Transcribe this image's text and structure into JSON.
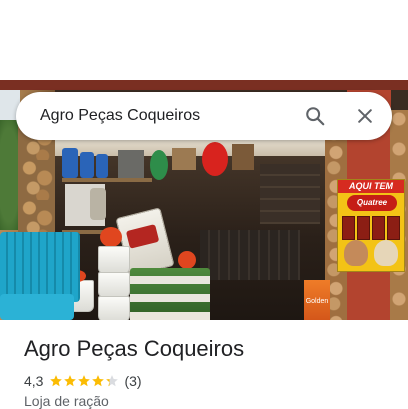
{
  "search": {
    "query": "Agro Peças Coqueiros",
    "search_icon": "search-icon",
    "clear_icon": "close-icon"
  },
  "photo": {
    "poster_heading": "AQUI TEM",
    "poster_brand": "Quatree",
    "bag_label": "Golden"
  },
  "place": {
    "name": "Agro Peças Coqueiros",
    "rating": "4,3",
    "rating_value": 4.3,
    "rating_max": 5,
    "review_count": "(3)",
    "category": "Loja de ração"
  },
  "colors": {
    "star": "#fbbc04",
    "star_empty": "#dadce0",
    "text_primary": "#202124",
    "text_secondary": "#5f6368"
  }
}
